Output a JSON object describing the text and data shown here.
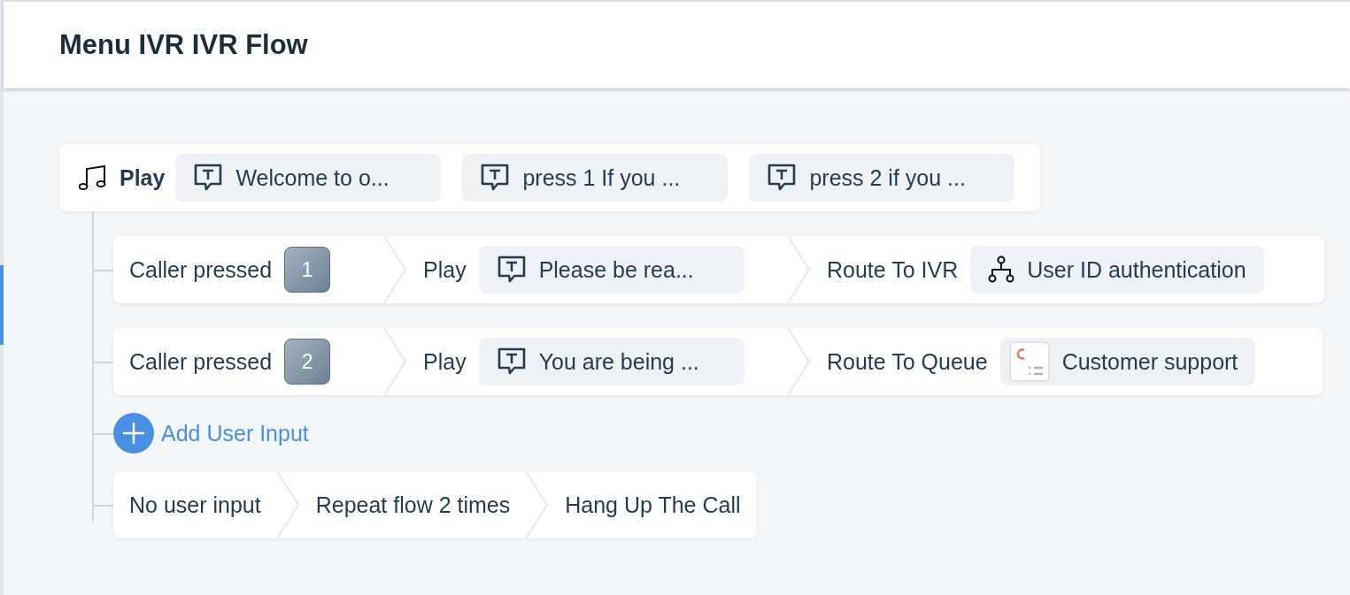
{
  "header": {
    "title": "Menu IVR IVR Flow"
  },
  "play": {
    "label": "Play",
    "messages": [
      "Welcome to o...",
      "press 1 If you ...",
      "press 2 if you ..."
    ]
  },
  "rows": [
    {
      "steps": [
        {
          "kind": "pressed",
          "label": "Caller pressed",
          "key": "1"
        },
        {
          "kind": "play",
          "label": "Play",
          "chip": "Please be rea..."
        },
        {
          "kind": "ivr",
          "label": "Route To IVR",
          "chip": "User ID authentication"
        }
      ]
    },
    {
      "steps": [
        {
          "kind": "pressed",
          "label": "Caller pressed",
          "key": "2"
        },
        {
          "kind": "play",
          "label": "Play",
          "chip": "You are being ..."
        },
        {
          "kind": "queue",
          "label": "Route To Queue",
          "chip": "Customer support"
        }
      ]
    }
  ],
  "add_input": {
    "label": "Add User Input"
  },
  "fallback": {
    "steps": [
      {
        "kind": "text",
        "label": "No user input"
      },
      {
        "kind": "text",
        "label": "Repeat flow 2 times"
      },
      {
        "kind": "text",
        "label": "Hang Up The Call"
      }
    ]
  }
}
